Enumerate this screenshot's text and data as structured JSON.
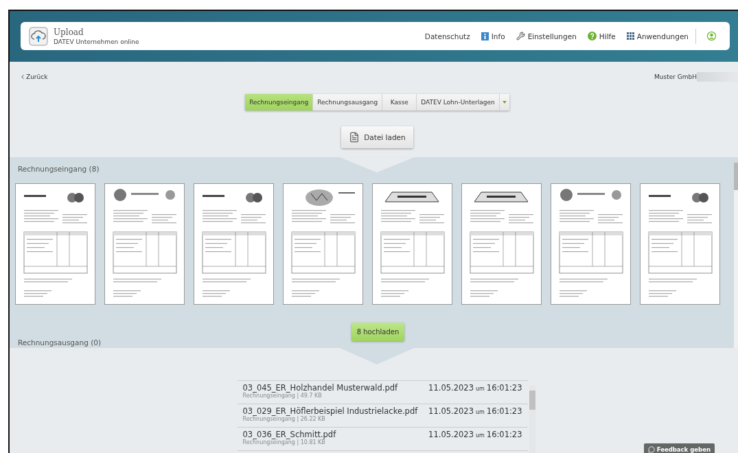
{
  "header": {
    "app_title": "Upload",
    "app_subtitle": "DATEV Unternehmen online",
    "nav": [
      {
        "label": "Datenschutz",
        "kind": "plain"
      },
      {
        "label": "Info",
        "kind": "info"
      },
      {
        "label": "Einstellungen",
        "kind": "wrench"
      },
      {
        "label": "Hilfe",
        "kind": "help"
      },
      {
        "label": "Anwendungen",
        "kind": "grid"
      }
    ]
  },
  "back_link": "Zurück",
  "company": "Muster GmbH",
  "tabs": [
    {
      "label": "Rechnungseingang",
      "selected": true
    },
    {
      "label": "Rechnungsausgang",
      "selected": false
    },
    {
      "label": "Kasse",
      "selected": false
    },
    {
      "label": "DATEV Lohn-Unterlagen",
      "selected": false
    }
  ],
  "load_button": "Datei laden",
  "incoming": {
    "title": "Rechnungseingang (8)",
    "upload_button": "8 hochladen",
    "documents": [
      {
        "kind": "right"
      },
      {
        "kind": "left"
      },
      {
        "kind": "right"
      },
      {
        "kind": "center"
      },
      {
        "kind": "banner"
      },
      {
        "kind": "banner"
      },
      {
        "kind": "left"
      },
      {
        "kind": "right"
      }
    ]
  },
  "outgoing": {
    "title": "Rechnungsausgang (0)"
  },
  "files": [
    {
      "name": "03_045_ER_Holzhandel Musterwald.pdf",
      "meta": "Rechnungseingang | 49.7 KB",
      "date": "11.05.2023",
      "at": "um",
      "time": "16:01:23"
    },
    {
      "name": "03_029_ER_Höflerbeispiel Industrielacke.pdf",
      "meta": "Rechnungseingang | 26.22 KB",
      "date": "11.05.2023",
      "at": "um",
      "time": "16:01:23"
    },
    {
      "name": "03_036_ER_Schmitt.pdf",
      "meta": "Rechnungseingang | 10.81 KB",
      "date": "11.05.2023",
      "at": "um",
      "time": "16:01:23"
    }
  ],
  "feedback_button": "Feedback geben"
}
